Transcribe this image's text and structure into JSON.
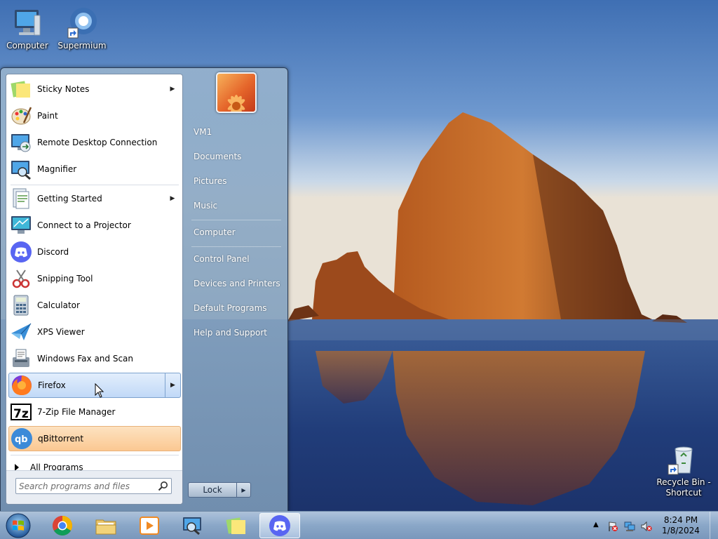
{
  "desktop": {
    "icons": [
      {
        "label": "Computer"
      },
      {
        "label": "Supermium"
      }
    ],
    "recycle_bin": {
      "label": "Recycle Bin - Shortcut"
    }
  },
  "start_menu": {
    "programs": [
      {
        "label": "Sticky Notes",
        "has_submenu": true,
        "icon": "sticky-notes-icon"
      },
      {
        "label": "Paint",
        "has_submenu": false,
        "icon": "paint-icon"
      },
      {
        "label": "Remote Desktop Connection",
        "has_submenu": false,
        "icon": "remote-desktop-icon"
      },
      {
        "label": "Magnifier",
        "has_submenu": false,
        "icon": "magnifier-icon"
      },
      {
        "label": "Getting Started",
        "has_submenu": true,
        "icon": "getting-started-icon"
      },
      {
        "label": "Connect to a Projector",
        "has_submenu": false,
        "icon": "projector-icon"
      },
      {
        "label": "Discord",
        "has_submenu": false,
        "icon": "discord-icon"
      },
      {
        "label": "Snipping Tool",
        "has_submenu": false,
        "icon": "snipping-tool-icon"
      },
      {
        "label": "Calculator",
        "has_submenu": false,
        "icon": "calculator-icon"
      },
      {
        "label": "XPS Viewer",
        "has_submenu": false,
        "icon": "xps-viewer-icon"
      },
      {
        "label": "Windows Fax and Scan",
        "has_submenu": false,
        "icon": "fax-scan-icon"
      },
      {
        "label": "Firefox",
        "has_submenu": true,
        "icon": "firefox-icon"
      },
      {
        "label": "7-Zip File Manager",
        "has_submenu": false,
        "icon": "7zip-icon"
      },
      {
        "label": "qBittorrent",
        "has_submenu": false,
        "icon": "qbittorrent-icon"
      }
    ],
    "all_programs_label": "All Programs",
    "search": {
      "placeholder": "Search programs and files",
      "value": ""
    },
    "right_items": [
      {
        "label": "VM1"
      },
      {
        "label": "Documents"
      },
      {
        "label": "Pictures"
      },
      {
        "label": "Music"
      },
      {
        "label": "Computer"
      },
      {
        "label": "Control Panel"
      },
      {
        "label": "Devices and Printers"
      },
      {
        "label": "Default Programs"
      },
      {
        "label": "Help and Support"
      }
    ],
    "lock_label": "Lock"
  },
  "taskbar": {
    "pinned": [
      {
        "icon": "chrome-icon"
      },
      {
        "icon": "file-explorer-icon"
      },
      {
        "icon": "media-player-icon"
      },
      {
        "icon": "remote-desktop-icon"
      },
      {
        "icon": "sticky-notes-icon"
      },
      {
        "icon": "discord-icon",
        "active": true
      }
    ],
    "clock": {
      "time": "8:24 PM",
      "date": "1/8/2024"
    }
  },
  "colors": {
    "hover_blue": "#c1d9f7",
    "highlight_orange": "#fbc892",
    "discord": "#5865f2"
  }
}
